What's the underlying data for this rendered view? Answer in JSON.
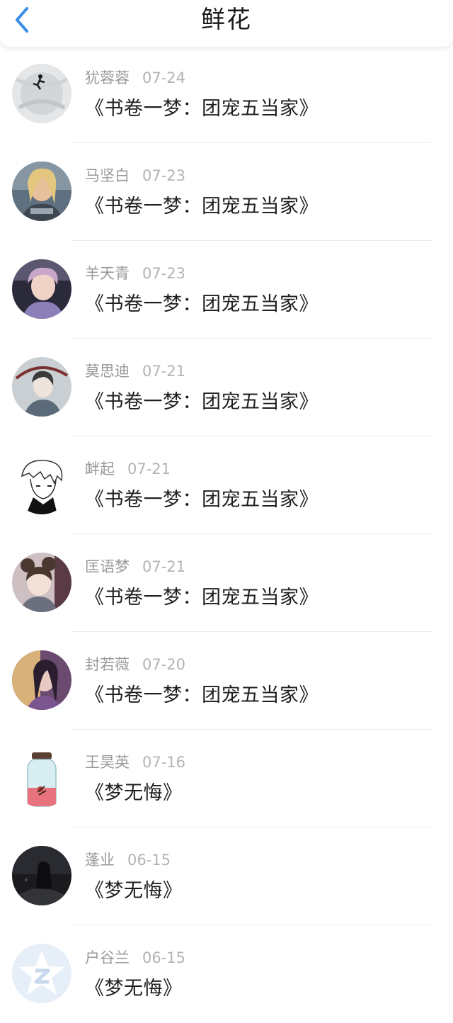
{
  "header": {
    "title": "鲜花",
    "back_icon": "chevron-left-icon",
    "accent_color": "#3a8ee6"
  },
  "items": [
    {
      "name": "犹蓉蓉",
      "date": "07-24",
      "book": "《书卷一梦：团宠五当家》"
    },
    {
      "name": "马坚白",
      "date": "07-23",
      "book": "《书卷一梦：团宠五当家》"
    },
    {
      "name": "羊天青",
      "date": "07-23",
      "book": "《书卷一梦：团宠五当家》"
    },
    {
      "name": "莫思迪",
      "date": "07-21",
      "book": "《书卷一梦：团宠五当家》"
    },
    {
      "name": "衅起",
      "date": "07-21",
      "book": "《书卷一梦：团宠五当家》"
    },
    {
      "name": "匡语梦",
      "date": "07-21",
      "book": "《书卷一梦：团宠五当家》"
    },
    {
      "name": "封若薇",
      "date": "07-20",
      "book": "《书卷一梦：团宠五当家》"
    },
    {
      "name": "王昊英",
      "date": "07-16",
      "book": "《梦无悔》"
    },
    {
      "name": "蓬业",
      "date": "06-15",
      "book": "《梦无悔》"
    },
    {
      "name": "户谷兰",
      "date": "06-15",
      "book": "《梦无悔》"
    }
  ]
}
